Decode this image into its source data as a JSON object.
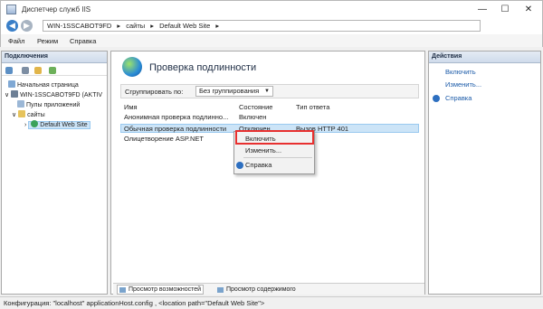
{
  "window": {
    "title": "Диспетчер служб IIS",
    "minimize": "—",
    "maximize": "☐",
    "close": "✕"
  },
  "address": {
    "back": "◀",
    "forward": "▶",
    "segments": [
      "WIN-1SSCABOT9FD",
      "▸",
      "сайты",
      "▸",
      "Default Web Site",
      "▸"
    ]
  },
  "menu": [
    "Файл",
    "Режим",
    "Справка"
  ],
  "left_panel": {
    "title": "Подключения",
    "tree": [
      "Начальная страница",
      "WIN-1SSCABOT9FD (AKTIV",
      "Пулы приложений",
      "сайты",
      "Default Web Site"
    ]
  },
  "center": {
    "title": "Проверка подлинности",
    "group_label": "Сгруппировать по:",
    "group_value": "Без группирования",
    "columns": [
      "Имя",
      "Состояние",
      "Тип ответа"
    ],
    "rows": [
      [
        "Анонимная проверка подлинно...",
        "Включен",
        ""
      ],
      [
        "Обычная проверка подлинности",
        "Отключен",
        "Вызов HTTP 401"
      ],
      [
        "Олицетворение ASP.NET",
        "",
        ""
      ]
    ],
    "context_menu": [
      "Включить",
      "Изменить...",
      "Справка"
    ],
    "bottom_tabs": [
      "Просмотр возможностей",
      "Просмотр содержимого"
    ]
  },
  "right_panel": {
    "title": "Действия",
    "actions": [
      "Включить",
      "Изменить...",
      "Справка"
    ]
  },
  "status": "Конфигурация: \"localhost\" applicationHost.config , <location path=\"Default Web Site\">",
  "colors": {
    "accent": "#1a5aa8",
    "selection": "#cce4f7",
    "highlight_border": "#e8302f"
  }
}
